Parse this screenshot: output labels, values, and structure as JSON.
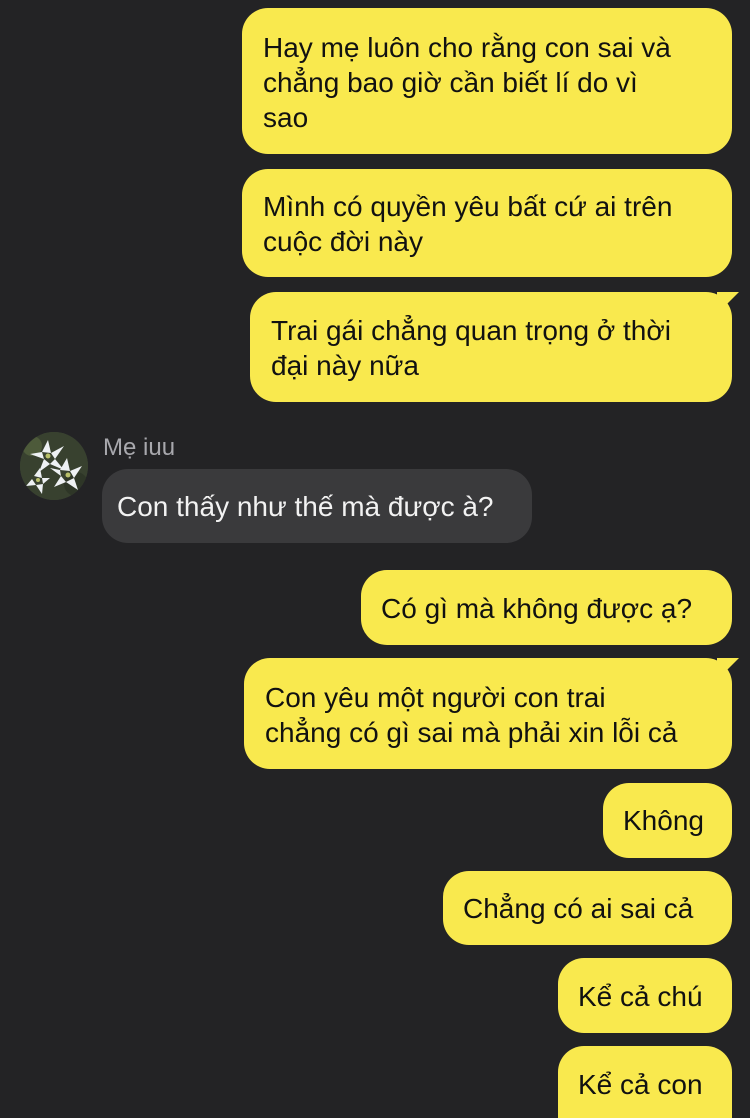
{
  "conversation": {
    "contact": {
      "name": "Mẹ iuu",
      "avatar_icon": "white-lily-flowers-avatar"
    },
    "messages": [
      {
        "from": "me",
        "text": "Hay mẹ luôn cho rằng con sai và\nchẳng bao giờ cần biết lí do vì\nsao"
      },
      {
        "from": "me",
        "text": "Mình có quyền yêu bất cứ ai trên\ncuộc đời này"
      },
      {
        "from": "me",
        "text": "Trai gái chẳng quan trọng ở thời\nđại này nữa"
      },
      {
        "from": "contact",
        "text": "Con thấy như thế mà được à?"
      },
      {
        "from": "me",
        "text": "Có gì mà không được ạ?"
      },
      {
        "from": "me",
        "text": "Con yêu một người con trai\nchẳng có gì sai mà phải xin lỗi cả"
      },
      {
        "from": "me",
        "text": "Không"
      },
      {
        "from": "me",
        "text": "Chẳng có ai sai cả"
      },
      {
        "from": "me",
        "text": "Kể cả chú"
      },
      {
        "from": "me",
        "text": "Kể cả con"
      }
    ]
  },
  "colors": {
    "background": "#232325",
    "outgoing_bubble": "#f9e94e",
    "incoming_bubble": "#3a3a3c",
    "sender_name": "#a8a8ad"
  }
}
